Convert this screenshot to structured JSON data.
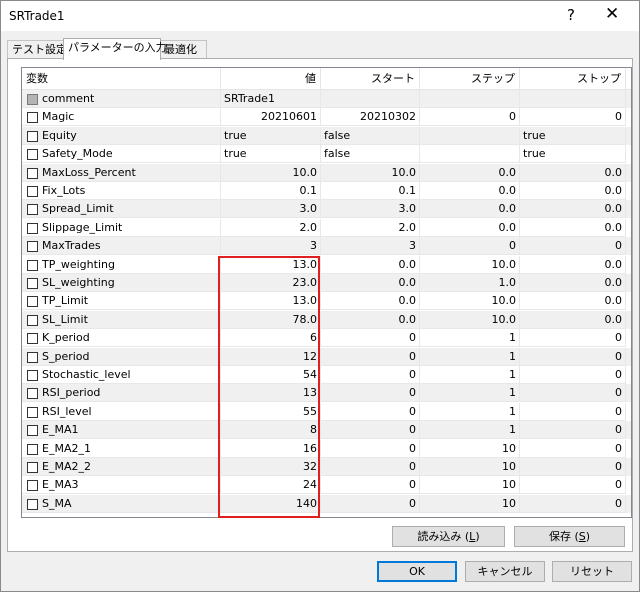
{
  "window": {
    "title": "SRTrade1",
    "help_glyph": "?",
    "close_glyph": "✕"
  },
  "tabs": [
    {
      "label": "テスト設定"
    },
    {
      "label": "パラメーターの入力"
    },
    {
      "label": "最適化"
    }
  ],
  "grid": {
    "columns": [
      "変数",
      "値",
      "スタート",
      "ステップ",
      "ストップ"
    ],
    "rows": [
      {
        "name": "comment",
        "value": "SRTrade1",
        "start": "",
        "step": "",
        "stop": "",
        "shaded": true,
        "checkbox": "gray",
        "align": "left"
      },
      {
        "name": "Magic",
        "value": "20210601",
        "start": "20210302",
        "step": "0",
        "stop": "0",
        "shaded": false,
        "checkbox": "white",
        "align": "right"
      },
      {
        "name": "Equity",
        "value": "true",
        "start": "false",
        "step": "",
        "stop": "true",
        "shaded": true,
        "checkbox": "white",
        "align": "left"
      },
      {
        "name": "Safety_Mode",
        "value": "true",
        "start": "false",
        "step": "",
        "stop": "true",
        "shaded": false,
        "checkbox": "white",
        "align": "left"
      },
      {
        "name": "MaxLoss_Percent",
        "value": "10.0",
        "start": "10.0",
        "step": "0.0",
        "stop": "0.0",
        "shaded": true,
        "checkbox": "white",
        "align": "right"
      },
      {
        "name": "Fix_Lots",
        "value": "0.1",
        "start": "0.1",
        "step": "0.0",
        "stop": "0.0",
        "shaded": false,
        "checkbox": "white",
        "align": "right"
      },
      {
        "name": "Spread_Limit",
        "value": "3.0",
        "start": "3.0",
        "step": "0.0",
        "stop": "0.0",
        "shaded": true,
        "checkbox": "white",
        "align": "right"
      },
      {
        "name": "Slippage_Limit",
        "value": "2.0",
        "start": "2.0",
        "step": "0.0",
        "stop": "0.0",
        "shaded": false,
        "checkbox": "white",
        "align": "right"
      },
      {
        "name": "MaxTrades",
        "value": "3",
        "start": "3",
        "step": "0",
        "stop": "0",
        "shaded": true,
        "checkbox": "white",
        "align": "right"
      },
      {
        "name": "TP_weighting",
        "value": "13.0",
        "start": "0.0",
        "step": "10.0",
        "stop": "0.0",
        "shaded": false,
        "checkbox": "white",
        "align": "right"
      },
      {
        "name": "SL_weighting",
        "value": "23.0",
        "start": "0.0",
        "step": "1.0",
        "stop": "0.0",
        "shaded": true,
        "checkbox": "white",
        "align": "right"
      },
      {
        "name": "TP_Limit",
        "value": "13.0",
        "start": "0.0",
        "step": "10.0",
        "stop": "0.0",
        "shaded": false,
        "checkbox": "white",
        "align": "right"
      },
      {
        "name": "SL_Limit",
        "value": "78.0",
        "start": "0.0",
        "step": "10.0",
        "stop": "0.0",
        "shaded": true,
        "checkbox": "white",
        "align": "right"
      },
      {
        "name": "K_period",
        "value": "6",
        "start": "0",
        "step": "1",
        "stop": "0",
        "shaded": false,
        "checkbox": "white",
        "align": "right"
      },
      {
        "name": "S_period",
        "value": "12",
        "start": "0",
        "step": "1",
        "stop": "0",
        "shaded": true,
        "checkbox": "white",
        "align": "right"
      },
      {
        "name": "Stochastic_level",
        "value": "54",
        "start": "0",
        "step": "1",
        "stop": "0",
        "shaded": false,
        "checkbox": "white",
        "align": "right"
      },
      {
        "name": "RSI_period",
        "value": "13",
        "start": "0",
        "step": "1",
        "stop": "0",
        "shaded": true,
        "checkbox": "white",
        "align": "right"
      },
      {
        "name": "RSI_level",
        "value": "55",
        "start": "0",
        "step": "1",
        "stop": "0",
        "shaded": false,
        "checkbox": "white",
        "align": "right"
      },
      {
        "name": "E_MA1",
        "value": "8",
        "start": "0",
        "step": "1",
        "stop": "0",
        "shaded": true,
        "checkbox": "white",
        "align": "right"
      },
      {
        "name": "E_MA2_1",
        "value": "16",
        "start": "0",
        "step": "10",
        "stop": "0",
        "shaded": false,
        "checkbox": "white",
        "align": "right"
      },
      {
        "name": "E_MA2_2",
        "value": "32",
        "start": "0",
        "step": "10",
        "stop": "0",
        "shaded": true,
        "checkbox": "white",
        "align": "right"
      },
      {
        "name": "E_MA3",
        "value": "24",
        "start": "0",
        "step": "10",
        "stop": "0",
        "shaded": false,
        "checkbox": "white",
        "align": "right"
      },
      {
        "name": "S_MA",
        "value": "140",
        "start": "0",
        "step": "10",
        "stop": "0",
        "shaded": true,
        "checkbox": "white",
        "align": "right"
      }
    ]
  },
  "panel_buttons": {
    "load": {
      "label": "読み込み (",
      "key": "L",
      "suffix": ")"
    },
    "save": {
      "label": "保存 (",
      "key": "S",
      "suffix": ")"
    }
  },
  "dialog_buttons": {
    "ok": "OK",
    "cancel": "キャンセル",
    "reset": "リセット"
  },
  "colors": {
    "highlight": "#e02020",
    "default_button_border": "#0078d7",
    "shaded_row": "#f0f0f0"
  }
}
